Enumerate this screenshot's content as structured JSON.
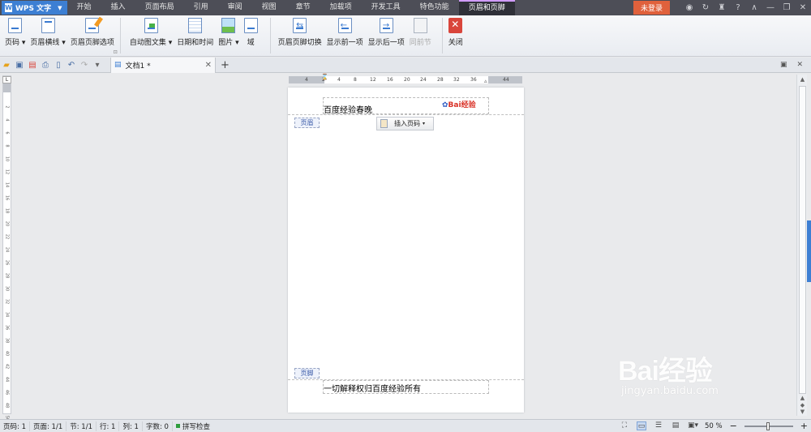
{
  "titlebar": {
    "app_name": "WPS 文字",
    "menu_tabs": [
      "开始",
      "插入",
      "页面布局",
      "引用",
      "审阅",
      "视图",
      "章节",
      "加载项",
      "开发工具",
      "特色功能",
      "页眉和页脚"
    ],
    "active_tab": "页眉和页脚",
    "login_label": "未登录"
  },
  "ribbon": {
    "buttons": [
      {
        "label": "页码",
        "dropdown": true
      },
      {
        "label": "页眉横线",
        "dropdown": true
      },
      {
        "label": "页眉页脚选项"
      },
      {
        "label": "自动图文集",
        "dropdown": true
      },
      {
        "label": "日期和时间"
      },
      {
        "label": "图片",
        "dropdown": true
      },
      {
        "label": "域"
      },
      {
        "label": "页眉页脚切换"
      },
      {
        "label": "显示前一项"
      },
      {
        "label": "显示后一项"
      },
      {
        "label": "同前节",
        "disabled": true
      },
      {
        "label": "关闭"
      }
    ]
  },
  "tabbar": {
    "doc_tab_label": "文档1 *"
  },
  "ruler": {
    "h_ticks": [
      "4",
      "2",
      "4",
      "8",
      "12",
      "16",
      "20",
      "24",
      "28",
      "32",
      "36",
      "44"
    ],
    "v_ticks": [
      "2",
      "4",
      "6",
      "8",
      "10",
      "12",
      "14",
      "16",
      "18",
      "20",
      "22",
      "24",
      "26",
      "28",
      "30",
      "32",
      "34",
      "36",
      "38",
      "40",
      "42",
      "44",
      "46",
      "48",
      "50"
    ]
  },
  "page": {
    "header_text": "百度经验春晚",
    "header_tag": "页眉",
    "insert_page_number_label": "插入页码",
    "footer_tag": "页脚",
    "footer_text": "一切解释权归百度经验所有",
    "header_logo_text": "Bai经验"
  },
  "watermark": {
    "brand": "Bai经验",
    "url": "jingyan.baidu.com"
  },
  "statusbar": {
    "page_num": "页码: 1",
    "pages": "页面: 1/1",
    "section": "节: 1/1",
    "row": "行: 1",
    "col": "列: 1",
    "word_count": "字数: 0",
    "spell_check": "拼写检查",
    "zoom": "50 %"
  },
  "colors": {
    "accent": "#3d7fd3",
    "login_button": "#e0613c",
    "titlebar_bg": "#4d4e57",
    "active_tab_marker": "#d09cff"
  }
}
